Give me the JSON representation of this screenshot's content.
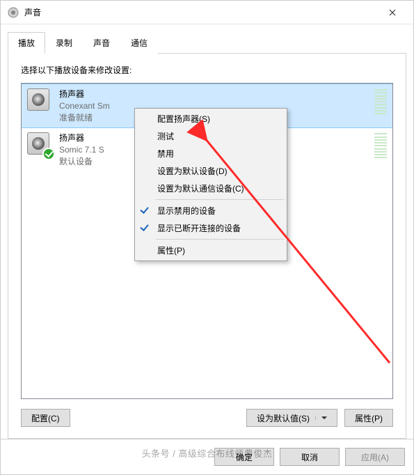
{
  "window": {
    "title": "声音"
  },
  "tabs": [
    "播放",
    "录制",
    "声音",
    "通信"
  ],
  "instr": "选择以下播放设备来修改设置:",
  "devices": [
    {
      "name": "扬声器",
      "sub": "Conexant Sm",
      "status": "准备就绪",
      "selected": true,
      "default": false
    },
    {
      "name": "扬声器",
      "sub": "Somic 7.1 S",
      "status": "默认设备",
      "selected": false,
      "default": true
    }
  ],
  "panel_buttons": {
    "configure": "配置(C)",
    "set_default": "设为默认值(S)",
    "properties": "属性(P)"
  },
  "dialog_buttons": {
    "ok": "确定",
    "cancel": "取消",
    "apply": "应用(A)"
  },
  "context_menu": {
    "configure": "配置扬声器(S)",
    "test": "测试",
    "disable": "禁用",
    "set_default": "设置为默认设备(D)",
    "set_default_comm": "设置为默认通信设备(C)",
    "show_disabled": "显示禁用的设备",
    "show_disconnected": "显示已断开连接的设备",
    "properties": "属性(P)"
  },
  "watermark": "头条号 / 高级综合布线师曹俊杰"
}
